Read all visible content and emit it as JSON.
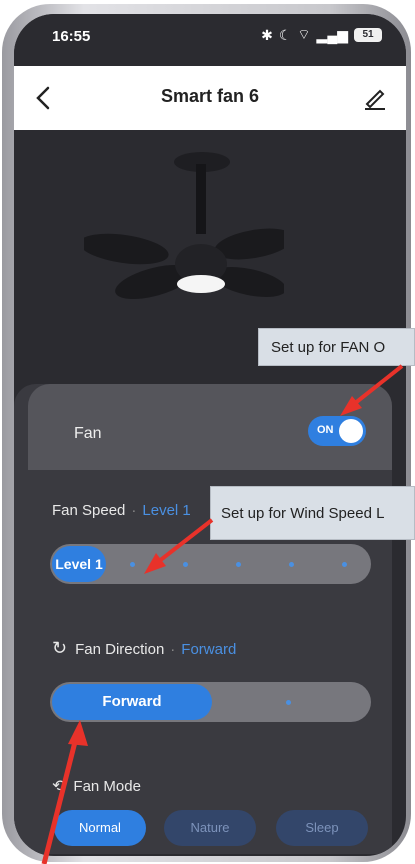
{
  "status": {
    "time": "16:55",
    "battery": "51"
  },
  "header": {
    "title": "Smart fan 6"
  },
  "fan": {
    "label": "Fan",
    "toggle_state": "ON"
  },
  "speed": {
    "label": "Fan Speed",
    "value": "Level 1",
    "pill": "Level 1",
    "level": 1,
    "levels": 6
  },
  "direction": {
    "label": "Fan Direction",
    "value": "Forward",
    "pill": "Forward"
  },
  "mode": {
    "label": "Fan Mode",
    "options": [
      "Normal",
      "Nature",
      "Sleep"
    ],
    "selected": "Normal"
  },
  "annotations": {
    "fan_on": "Set up for FAN O",
    "wind_speed": "Set up for Wind Speed L"
  },
  "colors": {
    "accent": "#2f7fe0",
    "arrow": "#e8322a"
  }
}
